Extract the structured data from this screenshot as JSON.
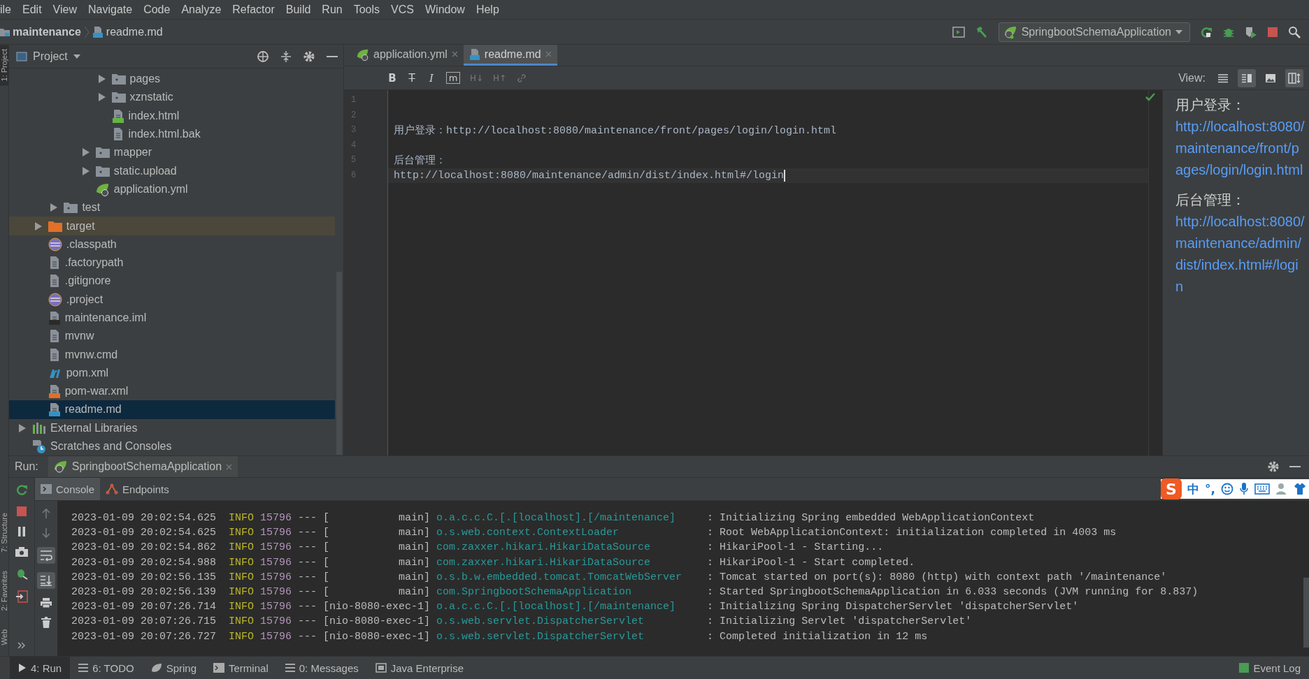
{
  "menu": [
    "ile",
    "Edit",
    "View",
    "Navigate",
    "Code",
    "Analyze",
    "Refactor",
    "Build",
    "Run",
    "Tools",
    "VCS",
    "Window",
    "Help"
  ],
  "breadcrumb": [
    "maintenance",
    "readme.md"
  ],
  "run_config": "SpringbootSchemaApplication",
  "side_stripe": {
    "top": "1: Project",
    "bottom": [
      "7: Structure",
      "2: Favorites",
      "Web"
    ]
  },
  "project_panel": {
    "title": "Project",
    "tree": [
      {
        "children": [
          {
            "children": [
              {
                "children": [
                  {
                    "children": [
                      {
                        "children": [
                          {
                            "label": "pages",
                            "kind": "folder",
                            "expanded": false,
                            "selected": false
                          },
                          {
                            "label": "xznstatic",
                            "kind": "folder",
                            "expanded": false,
                            "selected": false
                          },
                          {
                            "label": "index.html",
                            "kind": "html",
                            "selected": false
                          },
                          {
                            "label": "index.html.bak",
                            "kind": "text",
                            "selected": false
                          }
                        ]
                      },
                      {
                        "label": "mapper",
                        "kind": "folder",
                        "expanded": false,
                        "selected": false
                      },
                      {
                        "label": "static.upload",
                        "kind": "folder",
                        "expanded": false,
                        "selected": false
                      },
                      {
                        "label": "application.yml",
                        "kind": "spring",
                        "selected": false
                      }
                    ]
                  }
                ]
              },
              {
                "label": "test",
                "kind": "folder",
                "expanded": false,
                "selected": false
              }
            ]
          },
          {
            "label": "target",
            "kind": "excluded",
            "expanded": false,
            "selected": false
          },
          {
            "label": ".classpath",
            "kind": "eclipse",
            "selected": false
          },
          {
            "label": ".factorypath",
            "kind": "text",
            "selected": false
          },
          {
            "label": ".gitignore",
            "kind": "text",
            "selected": false
          },
          {
            "label": ".project",
            "kind": "eclipse",
            "selected": false
          },
          {
            "label": "maintenance.iml",
            "kind": "iml",
            "selected": false
          },
          {
            "label": "mvnw",
            "kind": "text",
            "selected": false
          },
          {
            "label": "mvnw.cmd",
            "kind": "text",
            "selected": false
          },
          {
            "label": "pom.xml",
            "kind": "maven",
            "selected": false
          },
          {
            "label": "pom-war.xml",
            "kind": "xml",
            "selected": false
          },
          {
            "label": "readme.md",
            "kind": "markdown",
            "selected": true
          }
        ]
      },
      {
        "label": "External Libraries",
        "kind": "libraries",
        "expanded": false,
        "selected": false
      },
      {
        "label": "Scratches and Consoles",
        "kind": "scratches",
        "selected": false
      }
    ]
  },
  "editor": {
    "tabs": [
      {
        "label": "application.yml",
        "kind": "spring",
        "selected": false
      },
      {
        "label": "readme.md",
        "kind": "markdown",
        "selected": true
      }
    ],
    "format_buttons": [
      {
        "label": "B",
        "kind": "bold",
        "disabled": false
      },
      {
        "label": "T",
        "kind": "strike",
        "disabled": false
      },
      {
        "label": "I",
        "kind": "italic",
        "disabled": false
      },
      {
        "label": "m",
        "kind": "code",
        "disabled": false
      },
      {
        "label": "H↓",
        "kind": "plain",
        "disabled": true
      },
      {
        "label": "H↑",
        "kind": "plain",
        "disabled": true
      },
      {
        "kind": "link",
        "disabled": true
      }
    ],
    "lines": [
      {
        "number": "1",
        "current": false
      },
      {
        "number": "2",
        "current": false
      },
      {
        "number": "3",
        "text": "用户登录：http://localhost:8080/maintenance/front/pages/login/login.html",
        "current": false
      },
      {
        "number": "4",
        "current": false
      },
      {
        "number": "5",
        "text": "后台管理：",
        "current": false
      },
      {
        "number": "6",
        "text": "http://localhost:8080/maintenance/admin/dist/index.html#/login",
        "current": true
      }
    ]
  },
  "preview": {
    "view_label": "View:",
    "view_buttons": [
      {
        "kind": "text",
        "selected": false
      },
      {
        "kind": "split",
        "selected": true
      },
      {
        "kind": "image",
        "selected": false
      },
      {
        "kind": "sync",
        "selected": true
      }
    ],
    "paragraphs": [
      {
        "label": "用户登录：",
        "link": "http://localhost:8080/maintenance/front/pages/login/login.html"
      },
      {
        "label": "后台管理：",
        "link": "http://localhost:8080/maintenance/admin/dist/index.html#/login"
      }
    ]
  },
  "run": {
    "label": "Run:",
    "tab": "SpringbootSchemaApplication",
    "subtabs": [
      {
        "label": "Console",
        "kind": "console",
        "selected": true
      },
      {
        "label": "Endpoints",
        "kind": "endpoints",
        "selected": false
      }
    ],
    "log": [
      {
        "time": "2023-01-09 20:02:54.625",
        "level": "INFO",
        "pid": "15796",
        "sep": "---",
        "thread": "[           main]",
        "logger": "o.a.c.c.C.[.[localhost].[/maintenance]",
        "message": ": Initializing Spring embedded WebApplicationContext"
      },
      {
        "time": "2023-01-09 20:02:54.625",
        "level": "INFO",
        "pid": "15796",
        "sep": "---",
        "thread": "[           main]",
        "logger": "o.s.web.context.ContextLoader",
        "message": ": Root WebApplicationContext: initialization completed in 4003 ms"
      },
      {
        "time": "2023-01-09 20:02:54.862",
        "level": "INFO",
        "pid": "15796",
        "sep": "---",
        "thread": "[           main]",
        "logger": "com.zaxxer.hikari.HikariDataSource",
        "message": ": HikariPool-1 - Starting..."
      },
      {
        "time": "2023-01-09 20:02:54.988",
        "level": "INFO",
        "pid": "15796",
        "sep": "---",
        "thread": "[           main]",
        "logger": "com.zaxxer.hikari.HikariDataSource",
        "message": ": HikariPool-1 - Start completed."
      },
      {
        "time": "2023-01-09 20:02:56.135",
        "level": "INFO",
        "pid": "15796",
        "sep": "---",
        "thread": "[           main]",
        "logger": "o.s.b.w.embedded.tomcat.TomcatWebServer",
        "message": ": Tomcat started on port(s): 8080 (http) with context path '/maintenance'"
      },
      {
        "time": "2023-01-09 20:02:56.139",
        "level": "INFO",
        "pid": "15796",
        "sep": "---",
        "thread": "[           main]",
        "logger": "com.SpringbootSchemaApplication",
        "message": ": Started SpringbootSchemaApplication in 6.033 seconds (JVM running for 8.837)"
      },
      {
        "time": "2023-01-09 20:07:26.714",
        "level": "INFO",
        "pid": "15796",
        "sep": "---",
        "thread": "[nio-8080-exec-1]",
        "logger": "o.a.c.c.C.[.[localhost].[/maintenance]",
        "message": ": Initializing Spring DispatcherServlet 'dispatcherServlet'"
      },
      {
        "time": "2023-01-09 20:07:26.715",
        "level": "INFO",
        "pid": "15796",
        "sep": "---",
        "thread": "[nio-8080-exec-1]",
        "logger": "o.s.web.servlet.DispatcherServlet",
        "message": ": Initializing Servlet 'dispatcherServlet'"
      },
      {
        "time": "2023-01-09 20:07:26.727",
        "level": "INFO",
        "pid": "15796",
        "sep": "---",
        "thread": "[nio-8080-exec-1]",
        "logger": "o.s.web.servlet.DispatcherServlet",
        "message": ": Completed initialization in 12 ms"
      }
    ]
  },
  "ime": {
    "logo": "S",
    "mode": "中",
    "punct": "°,"
  },
  "tool_windows": [
    {
      "label": "4: Run",
      "kind": "run",
      "selected": true
    },
    {
      "label": "6: TODO",
      "kind": "todo",
      "selected": false
    },
    {
      "label": "Spring",
      "kind": "spring",
      "selected": false
    },
    {
      "label": "Terminal",
      "kind": "terminal",
      "selected": false
    },
    {
      "label": "0: Messages",
      "kind": "messages",
      "selected": false
    },
    {
      "label": "Java Enterprise",
      "kind": "enterprise",
      "selected": false
    }
  ],
  "event_log": "Event Log"
}
